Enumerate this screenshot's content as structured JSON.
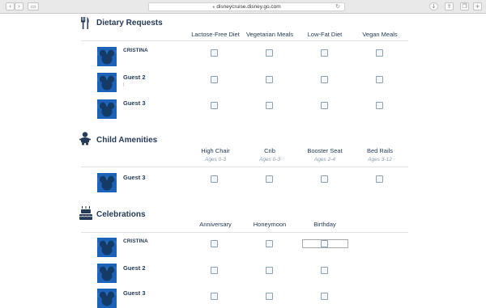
{
  "browser": {
    "url": "disneycruise.disney.go.com"
  },
  "dietary": {
    "title": "Dietary Requests",
    "columns": [
      "Lactose-Free Diet",
      "Vegetarian Meals",
      "Low-Fat Diet",
      "Vegan Meals"
    ],
    "guests": [
      "CRISTINA",
      "Guest 2",
      "Guest 3"
    ]
  },
  "child": {
    "title": "Child Amenities",
    "columns": [
      {
        "label": "High Chair",
        "sub": "Ages 0-3"
      },
      {
        "label": "Crib",
        "sub": "Ages 0-3"
      },
      {
        "label": "Booster Seat",
        "sub": "Ages 2-4"
      },
      {
        "label": "Bed Rails",
        "sub": "Ages 3-12"
      }
    ],
    "guests": [
      "Guest 3"
    ]
  },
  "celebrations": {
    "title": "Celebrations",
    "columns": [
      "Anniversary",
      "Honeymoon",
      "Birthday"
    ],
    "guests": [
      "CRISTINA",
      "Guest 2",
      "Guest 3"
    ]
  },
  "colors": {
    "navy": "#253b56",
    "avatar_blue": "#1c62b8"
  },
  "icons": [
    "utensils-icon",
    "baby-icon",
    "cake-icon",
    "mickey-avatar-icon"
  ]
}
